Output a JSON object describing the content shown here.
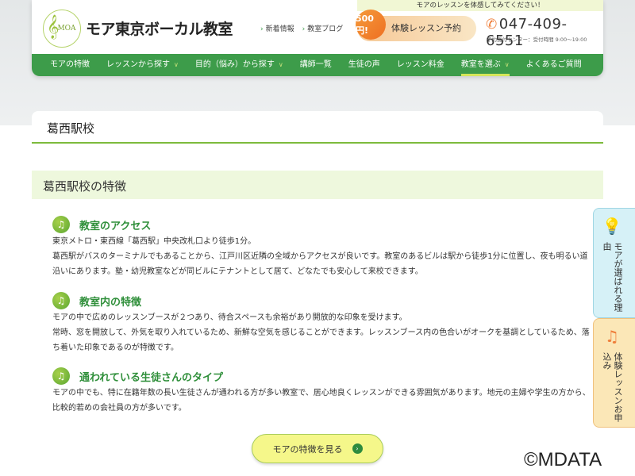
{
  "header": {
    "logo_text": "MOA",
    "site_title": "モア東京ボーカル教室",
    "links": [
      "新着情報",
      "教室ブログ"
    ],
    "promo": "モアのレッスンを体感してみてください！",
    "trial_badge": "500円!",
    "trial_label": "体験レッスン予約",
    "phone": "047-409-6551",
    "hours": "予約受付センター：受付時間 9:00〜19:00"
  },
  "nav": [
    {
      "label": "モアの特徴"
    },
    {
      "label": "レッスンから探す",
      "dropdown": true
    },
    {
      "label": "目的（悩み）から探す",
      "dropdown": true
    },
    {
      "label": "講師一覧"
    },
    {
      "label": "生徒の声"
    },
    {
      "label": "レッスン料金"
    },
    {
      "label": "教室を選ぶ",
      "dropdown": true,
      "active": true
    },
    {
      "label": "よくあるご質問"
    }
  ],
  "page_title": "葛西駅校",
  "section_title": "葛西駅校の特徴",
  "subsections": [
    {
      "title": "教室のアクセス",
      "lines": [
        "東京メトロ・東西線「葛西駅」中央改札口より徒歩1分。",
        "葛西駅がバスのターミナルでもあることから、江戸川区近隣の全域からアクセスが良いです。教室のあるビルは駅から徒歩1分に位置し、夜も明るい道沿いにあります。塾・幼児教室などが同ビルにテナントとして居て、どなたでも安心して来校できます。"
      ]
    },
    {
      "title": "教室内の特徴",
      "lines": [
        "モアの中で広めのレッスンブースが２つあり、待合スペースも余裕があり開放的な印象を受けます。",
        "常時、窓を開放して、外気を取り入れているため、新鮮な空気を感じることができます。レッスンブース内の色合いがオークを基調としているため、落ち着いた印象であるのが特徴です。"
      ]
    },
    {
      "title": "通われている生徒さんのタイプ",
      "lines": [
        "モアの中でも、特に在籍年数の長い生徒さんが通われる方が多い教室で、居心地良くレッスンができる雰囲気があります。地元の主婦や学生の方から、比較的若めの会社員の方が多いです。"
      ]
    }
  ],
  "cta": "モアの特徴を見る",
  "side": {
    "reason": "モアが選ばれる理由",
    "trial": "体験レッスンお申込み"
  },
  "watermark": "©MDATA"
}
